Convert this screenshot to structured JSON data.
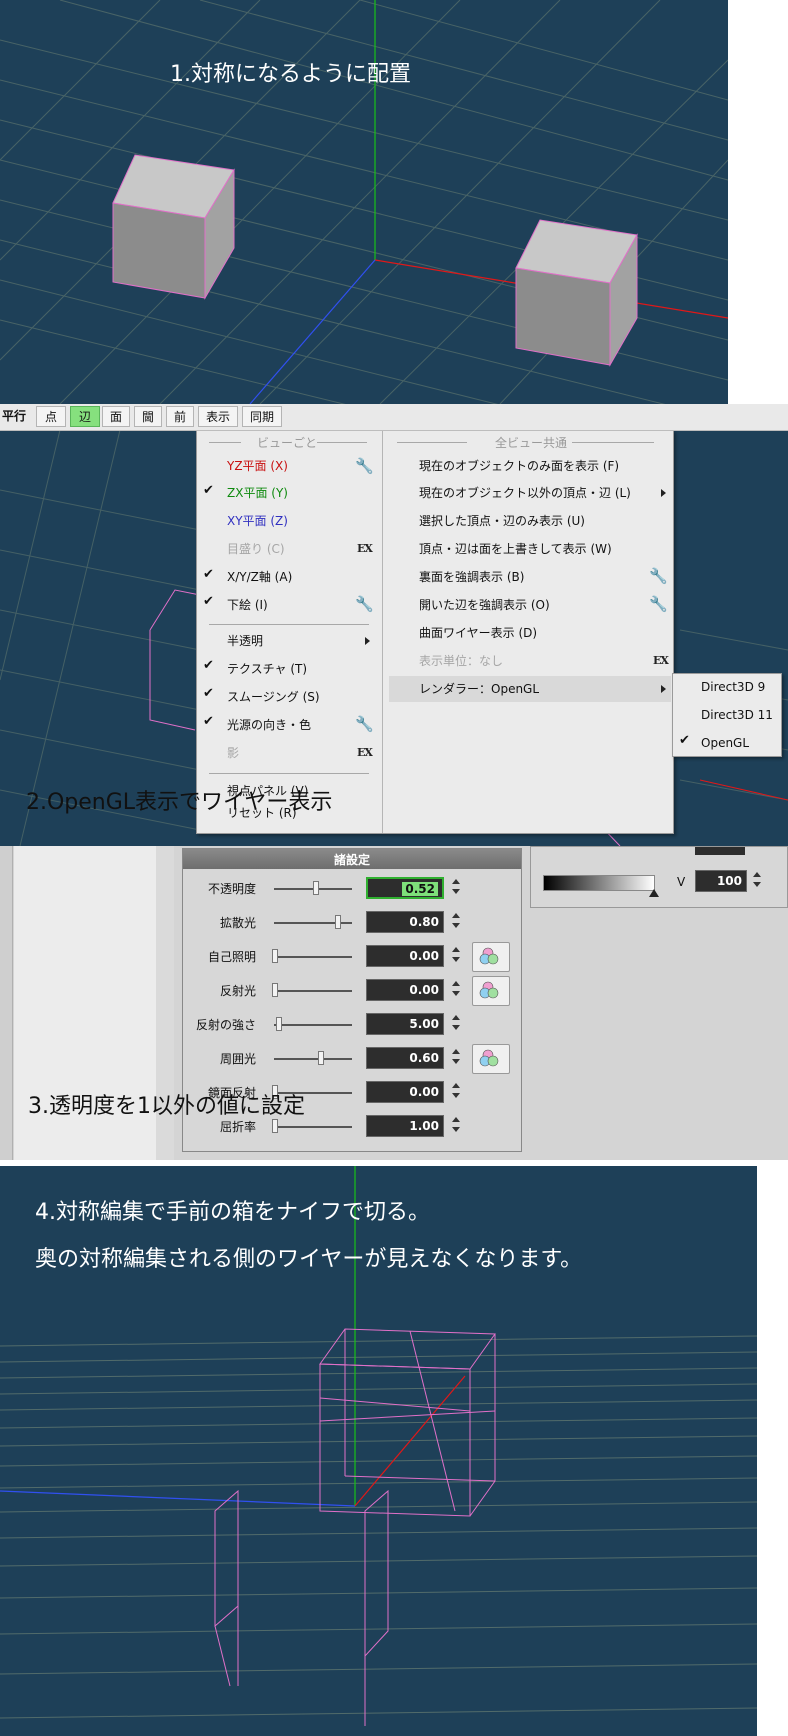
{
  "section1": {
    "caption": "1.対称になるように配置"
  },
  "toolbar": {
    "items": [
      "平行",
      "点",
      "辺",
      "面",
      "閫",
      "前",
      "表示",
      "同期"
    ]
  },
  "view_menu": {
    "per_view_header": "ビューごと",
    "per_view_items": [
      {
        "label": "YZ平面 (X)",
        "checked": false,
        "color": "#c81010",
        "wrench": true
      },
      {
        "label": "ZX平面 (Y)",
        "checked": true,
        "color": "#0f8a0f",
        "wrench": false
      },
      {
        "label": "XY平面 (Z)",
        "checked": false,
        "color": "#3030c0",
        "wrench": false
      },
      {
        "label": "目盛り (C)",
        "checked": false,
        "disabled": true,
        "ex": true
      },
      {
        "label": "X/Y/Z軸 (A)",
        "checked": true
      },
      {
        "label": "下絵 (I)",
        "checked": true,
        "wrench": true
      },
      {
        "label": "半透明",
        "submenu": true
      },
      {
        "label": "テクスチャ (T)",
        "checked": true
      },
      {
        "label": "スムージング (S)",
        "checked": true
      },
      {
        "label": "光源の向き・色",
        "checked": true,
        "wrench": true
      },
      {
        "label": "影",
        "disabled": true,
        "ex": true
      },
      {
        "label": "視点パネル (V)"
      },
      {
        "label": "リセット (R)"
      }
    ],
    "all_view_header": "全ビュー共通",
    "all_view_items": [
      {
        "label": "現在のオブジェクトのみ面を表示 (F)"
      },
      {
        "label": "現在のオブジェクト以外の頂点・辺 (L)",
        "submenu": true
      },
      {
        "label": "選択した頂点・辺のみ表示 (U)"
      },
      {
        "label": "頂点・辺は面を上書きして表示 (W)"
      },
      {
        "label": "裏面を強調表示 (B)",
        "wrench": true
      },
      {
        "label": "開いた辺を強調表示 (O)",
        "wrench": true
      },
      {
        "label": "曲面ワイヤー表示 (D)"
      },
      {
        "label": "表示単位：なし",
        "disabled": true,
        "ex": true
      },
      {
        "label": "レンダラー：OpenGL",
        "submenu": true,
        "highlighted": true
      }
    ],
    "renderer_submenu": [
      {
        "label": "Direct3D 9",
        "checked": false
      },
      {
        "label": "Direct3D 11",
        "checked": false
      },
      {
        "label": "OpenGL",
        "checked": true
      }
    ],
    "ex_label": "EX"
  },
  "section2": {
    "caption": "2.OpenGL表示でワイヤー表示"
  },
  "material_panel": {
    "title": "諸設定",
    "rows": [
      {
        "label": "不透明度",
        "value": "0.52",
        "slider": 0.52,
        "active": true,
        "color_button": false
      },
      {
        "label": "拡散光",
        "value": "0.80",
        "slider": 0.8,
        "color_button": false
      },
      {
        "label": "自己照明",
        "value": "0.00",
        "slider": 0.0,
        "color_button": true
      },
      {
        "label": "反射光",
        "value": "0.00",
        "slider": 0.0,
        "color_button": true
      },
      {
        "label": "反射の強さ",
        "value": "5.00",
        "slider": 0.05,
        "color_button": false
      },
      {
        "label": "周囲光",
        "value": "0.60",
        "slider": 0.6,
        "color_button": true
      },
      {
        "label": "鏡面反射",
        "value": "0.00",
        "slider": 0.0,
        "color_button": false
      },
      {
        "label": "屈折率",
        "value": "1.00",
        "slider": 0.0,
        "color_button": false
      }
    ],
    "v_label": "V",
    "v_value": "100"
  },
  "section3": {
    "caption": "3.透明度を1以外の値に設定"
  },
  "section4": {
    "caption_line1": "4.対称編集で手前の箱をナイフで切る。",
    "caption_line2": "奥の対称編集される側のワイヤーが見えなくなります。"
  },
  "colors": {
    "viewport_bg": "#1e4058",
    "grid": "#7c8f7a",
    "wire_pink": "#e070c8",
    "axis_red": "#e01818",
    "axis_green": "#18c018",
    "axis_blue": "#3050f0",
    "highlight": "#86e07e"
  }
}
